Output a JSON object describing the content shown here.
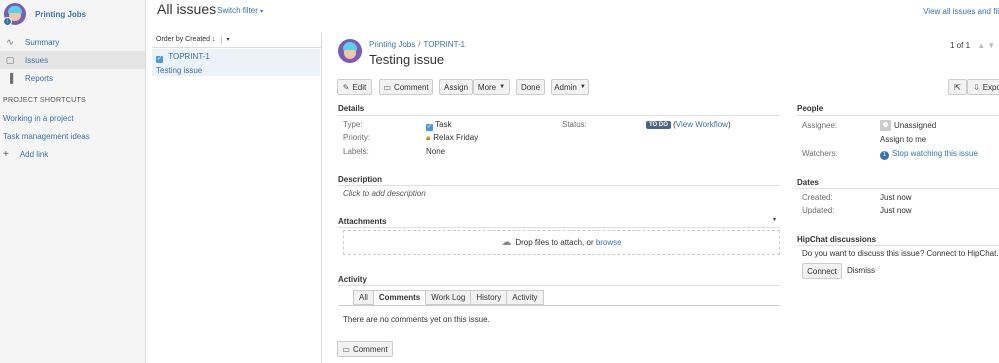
{
  "sidebar": {
    "project_name": "Printing Jobs",
    "badge": "⋮",
    "nav": [
      {
        "label": "Summary",
        "icon": "summary-icon",
        "glyph": "∿"
      },
      {
        "label": "Issues",
        "icon": "issues-icon",
        "glyph": "▢"
      },
      {
        "label": "Reports",
        "icon": "reports-icon",
        "glyph": "▐"
      }
    ],
    "shortcuts_title": "PROJECT SHORTCUTS",
    "shortcuts": [
      "Working in a project",
      "Task management ideas"
    ],
    "add_link": "Add link"
  },
  "header": {
    "title": "All issues",
    "switch_filter": "Switch filter",
    "view_all": "View all issues and fil"
  },
  "list": {
    "order_label": "Order by Created",
    "items": [
      {
        "key": "TOPRINT-1",
        "summary": "Testing issue"
      }
    ]
  },
  "issue": {
    "breadcrumb_project": "Printing Jobs",
    "breadcrumb_key": "TOPRINT-1",
    "title": "Testing issue",
    "pager": "1 of 1",
    "toolbar": {
      "edit": "Edit",
      "comment": "Comment",
      "assign": "Assign",
      "more": "More",
      "done": "Done",
      "admin": "Admin",
      "export": "Expo"
    },
    "details": {
      "heading": "Details",
      "type_label": "Type:",
      "type_value": "Task",
      "priority_label": "Priority:",
      "priority_value": "Relax Friday",
      "labels_label": "Labels:",
      "labels_value": "None",
      "status_label": "Status:",
      "status_value": "TO DO",
      "view_workflow": "View Workflow"
    },
    "description": {
      "heading": "Description",
      "placeholder": "Click to add description"
    },
    "attachments": {
      "heading": "Attachments",
      "drop_text": "Drop files to attach, or",
      "browse": "browse"
    },
    "activity": {
      "heading": "Activity",
      "tabs": [
        "All",
        "Comments",
        "Work Log",
        "History",
        "Activity"
      ],
      "active_tab": "Comments",
      "empty": "There are no comments yet on this issue.",
      "comment_button": "Comment"
    },
    "people": {
      "heading": "People",
      "assignee_label": "Assignee:",
      "assignee_value": "Unassigned",
      "assign_to_me": "Assign to me",
      "watchers_label": "Watchers:",
      "watchers_count": "1",
      "stop_watching": "Stop watching this issue"
    },
    "dates": {
      "heading": "Dates",
      "created_label": "Created:",
      "created_value": "Just now",
      "updated_label": "Updated:",
      "updated_value": "Just now"
    },
    "hipchat": {
      "heading": "HipChat discussions",
      "prompt": "Do you want to discuss this issue? Connect to HipChat.",
      "connect": "Connect",
      "dismiss": "Dismiss"
    }
  },
  "colors": {
    "link": "#3b73af",
    "todo": "#4a6785",
    "accent": "#3572b0"
  }
}
